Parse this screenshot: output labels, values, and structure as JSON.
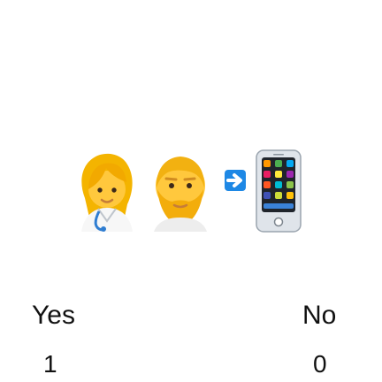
{
  "emoji_row": {
    "items": [
      {
        "icon": "woman-health-worker-icon",
        "color": "#ffc83d"
      },
      {
        "icon": "bearded-man-icon",
        "color": "#ffc83d"
      },
      {
        "icon": "right-arrow-icon",
        "color": "#1e88e5"
      },
      {
        "icon": "mobile-phone-icon",
        "color": "#dfe4ea"
      }
    ]
  },
  "options": [
    {
      "label": "Yes",
      "value": "1"
    },
    {
      "label": "No",
      "value": "0"
    }
  ]
}
